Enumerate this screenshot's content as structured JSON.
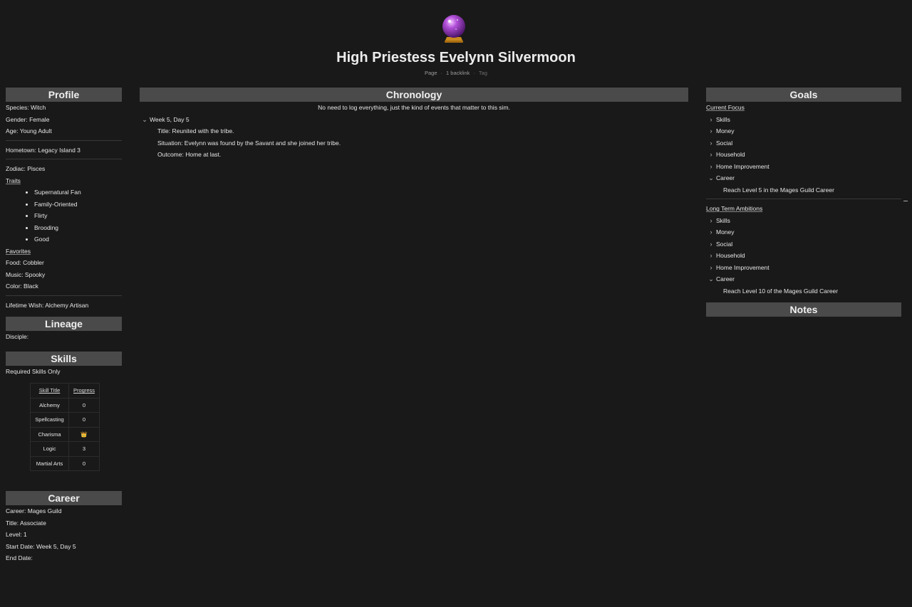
{
  "page": {
    "title": "High Priestess Evelynn Silvermoon",
    "meta_type": "Page",
    "meta_backlinks": "1 backlink",
    "meta_tag": "Tag",
    "icon": "crystal-ball-icon"
  },
  "profile": {
    "header": "Profile",
    "species": "Species: Witch",
    "gender": "Gender: Female",
    "age": "Age: Young Adult",
    "hometown": "Hometown: Legacy Island 3",
    "zodiac": "Zodiac: Pisces",
    "traits_label": "Traits",
    "traits": [
      "Supernatural Fan",
      "Family-Oriented",
      "Flirty",
      "Brooding",
      "Good"
    ],
    "favorites_label": "Favorites",
    "food": "Food: Cobbler",
    "music": "Music: Spooky",
    "color": "Color: Black",
    "lifetime_wish": "Lifetime Wish: Alchemy Artisan"
  },
  "lineage": {
    "header": "Lineage",
    "disciple": "Disciple:"
  },
  "skills": {
    "header": "Skills",
    "subtitle": "Required Skills Only",
    "col_title": "Skill Title",
    "col_progress": "Progress",
    "rows": [
      {
        "name": "Alchemy",
        "progress": "0"
      },
      {
        "name": "Spellcasting",
        "progress": "0"
      },
      {
        "name": "Charisma",
        "progress": "👑"
      },
      {
        "name": "Logic",
        "progress": "3"
      },
      {
        "name": "Martial Arts",
        "progress": "0"
      }
    ]
  },
  "career": {
    "header": "Career",
    "career": "Career: Mages Guild",
    "title": "Title: Associate",
    "level": "Level: 1",
    "start_date": "Start Date: Week 5, Day 5",
    "end_date": "End Date:"
  },
  "chronology": {
    "header": "Chronology",
    "subtitle": "No need to log everything, just the kind of events that matter to this sim.",
    "entries": [
      {
        "label": "Week 5, Day 5",
        "title": "Title: Reunited with the tribe.",
        "situation": "Situation: Evelynn was found by the Savant and she joined her tribe.",
        "outcome": "Outcome: Home at last."
      }
    ]
  },
  "goals": {
    "header": "Goals",
    "current_focus": {
      "label": "Current Focus",
      "items": [
        "Skills",
        "Money",
        "Social",
        "Household",
        "Home Improvement",
        "Career"
      ],
      "career_detail": "Reach Level 5 in the Mages Guild Career"
    },
    "long_term": {
      "label": "Long Term Ambitions",
      "items": [
        "Skills",
        "Money",
        "Social",
        "Household",
        "Home Improvement",
        "Career"
      ],
      "career_detail": "Reach Level 10 of the Mages Guild Career"
    }
  },
  "notes": {
    "header": "Notes"
  }
}
